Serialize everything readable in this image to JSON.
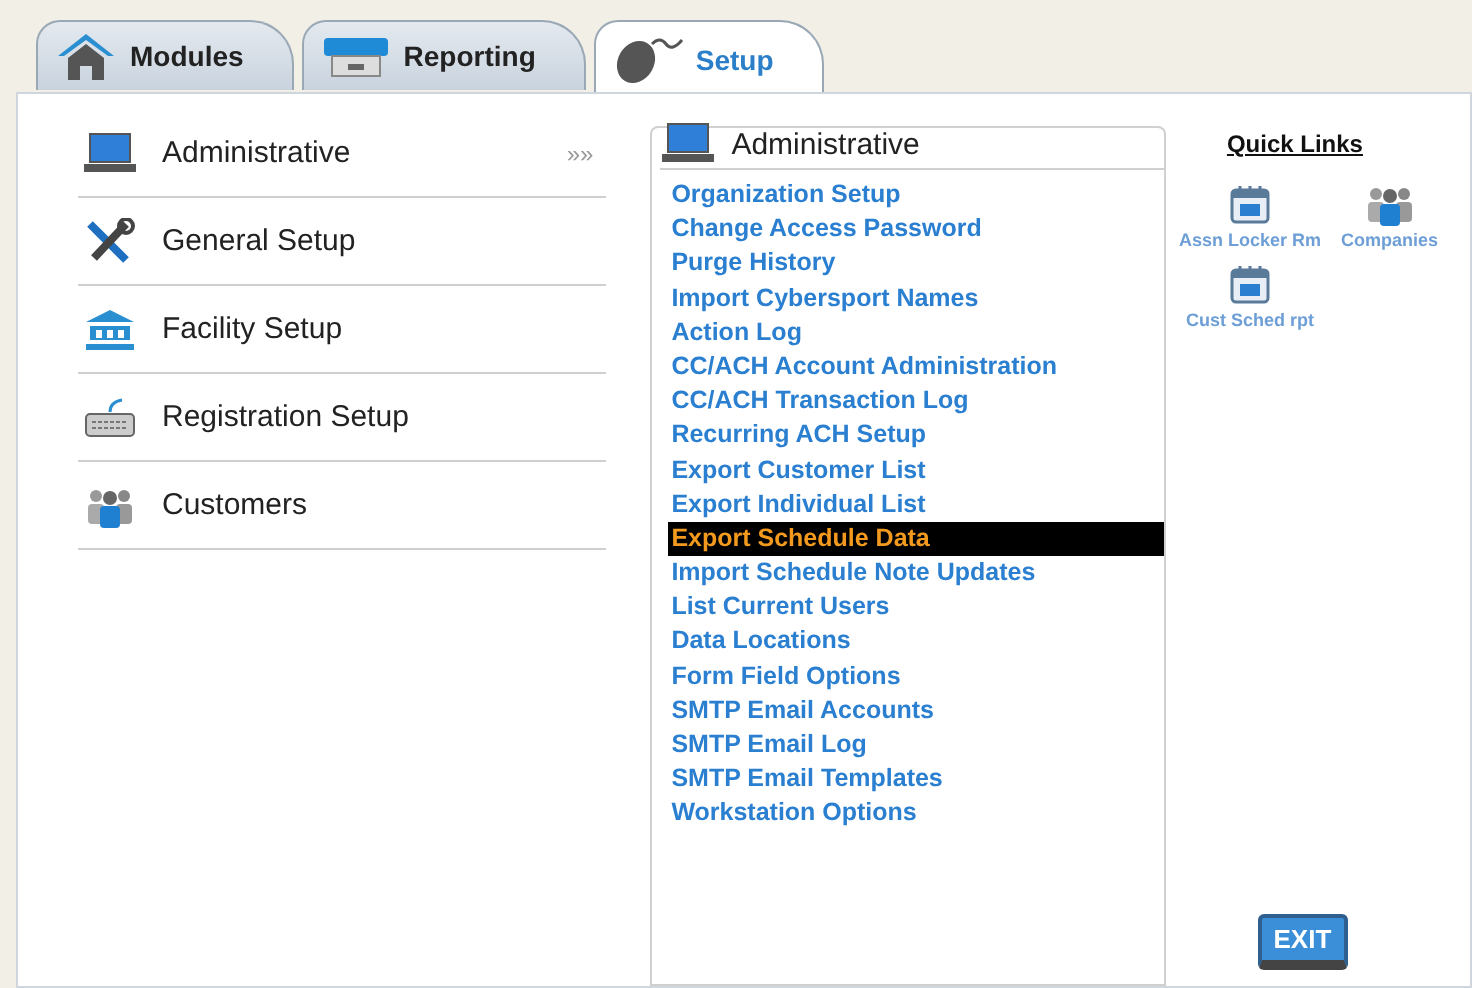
{
  "tabs": [
    {
      "label": "Modules",
      "selected": false
    },
    {
      "label": "Reporting",
      "selected": false
    },
    {
      "label": "Setup",
      "selected": true
    }
  ],
  "sidebar": {
    "items": [
      {
        "label": "Administrative",
        "arrow": "»»"
      },
      {
        "label": "General Setup"
      },
      {
        "label": "Facility Setup"
      },
      {
        "label": "Registration Setup"
      },
      {
        "label": "Customers"
      }
    ]
  },
  "panel": {
    "title": "Administrative",
    "items": [
      {
        "label": "Organization Setup",
        "selected": false
      },
      {
        "label": "Change Access Password",
        "selected": false
      },
      {
        "label": "Purge History",
        "selected": false
      },
      {
        "label": "Import Cybersport Names",
        "selected": false
      },
      {
        "label": "Action Log",
        "selected": false
      },
      {
        "label": "CC/ACH Account Administration",
        "selected": false
      },
      {
        "label": "CC/ACH Transaction Log",
        "selected": false
      },
      {
        "label": "Recurring ACH Setup",
        "selected": false
      },
      {
        "label": "Export Customer List",
        "selected": false
      },
      {
        "label": "Export Individual List",
        "selected": false
      },
      {
        "label": "Export Schedule Data",
        "selected": true
      },
      {
        "label": "Import Schedule Note Updates",
        "selected": false
      },
      {
        "label": "List Current Users",
        "selected": false
      },
      {
        "label": "Data Locations",
        "selected": false
      },
      {
        "label": "Form Field Options",
        "selected": false
      },
      {
        "label": "SMTP Email Accounts",
        "selected": false
      },
      {
        "label": "SMTP Email Log",
        "selected": false
      },
      {
        "label": "SMTP Email Templates",
        "selected": false
      },
      {
        "label": "Workstation Options",
        "selected": false
      }
    ]
  },
  "quick_links": {
    "title": "Quick Links",
    "items": [
      {
        "label": "Assn Locker Rm"
      },
      {
        "label": "Companies"
      },
      {
        "label": "Cust Sched rpt"
      }
    ]
  },
  "exit_button": {
    "label": "EXIT"
  }
}
